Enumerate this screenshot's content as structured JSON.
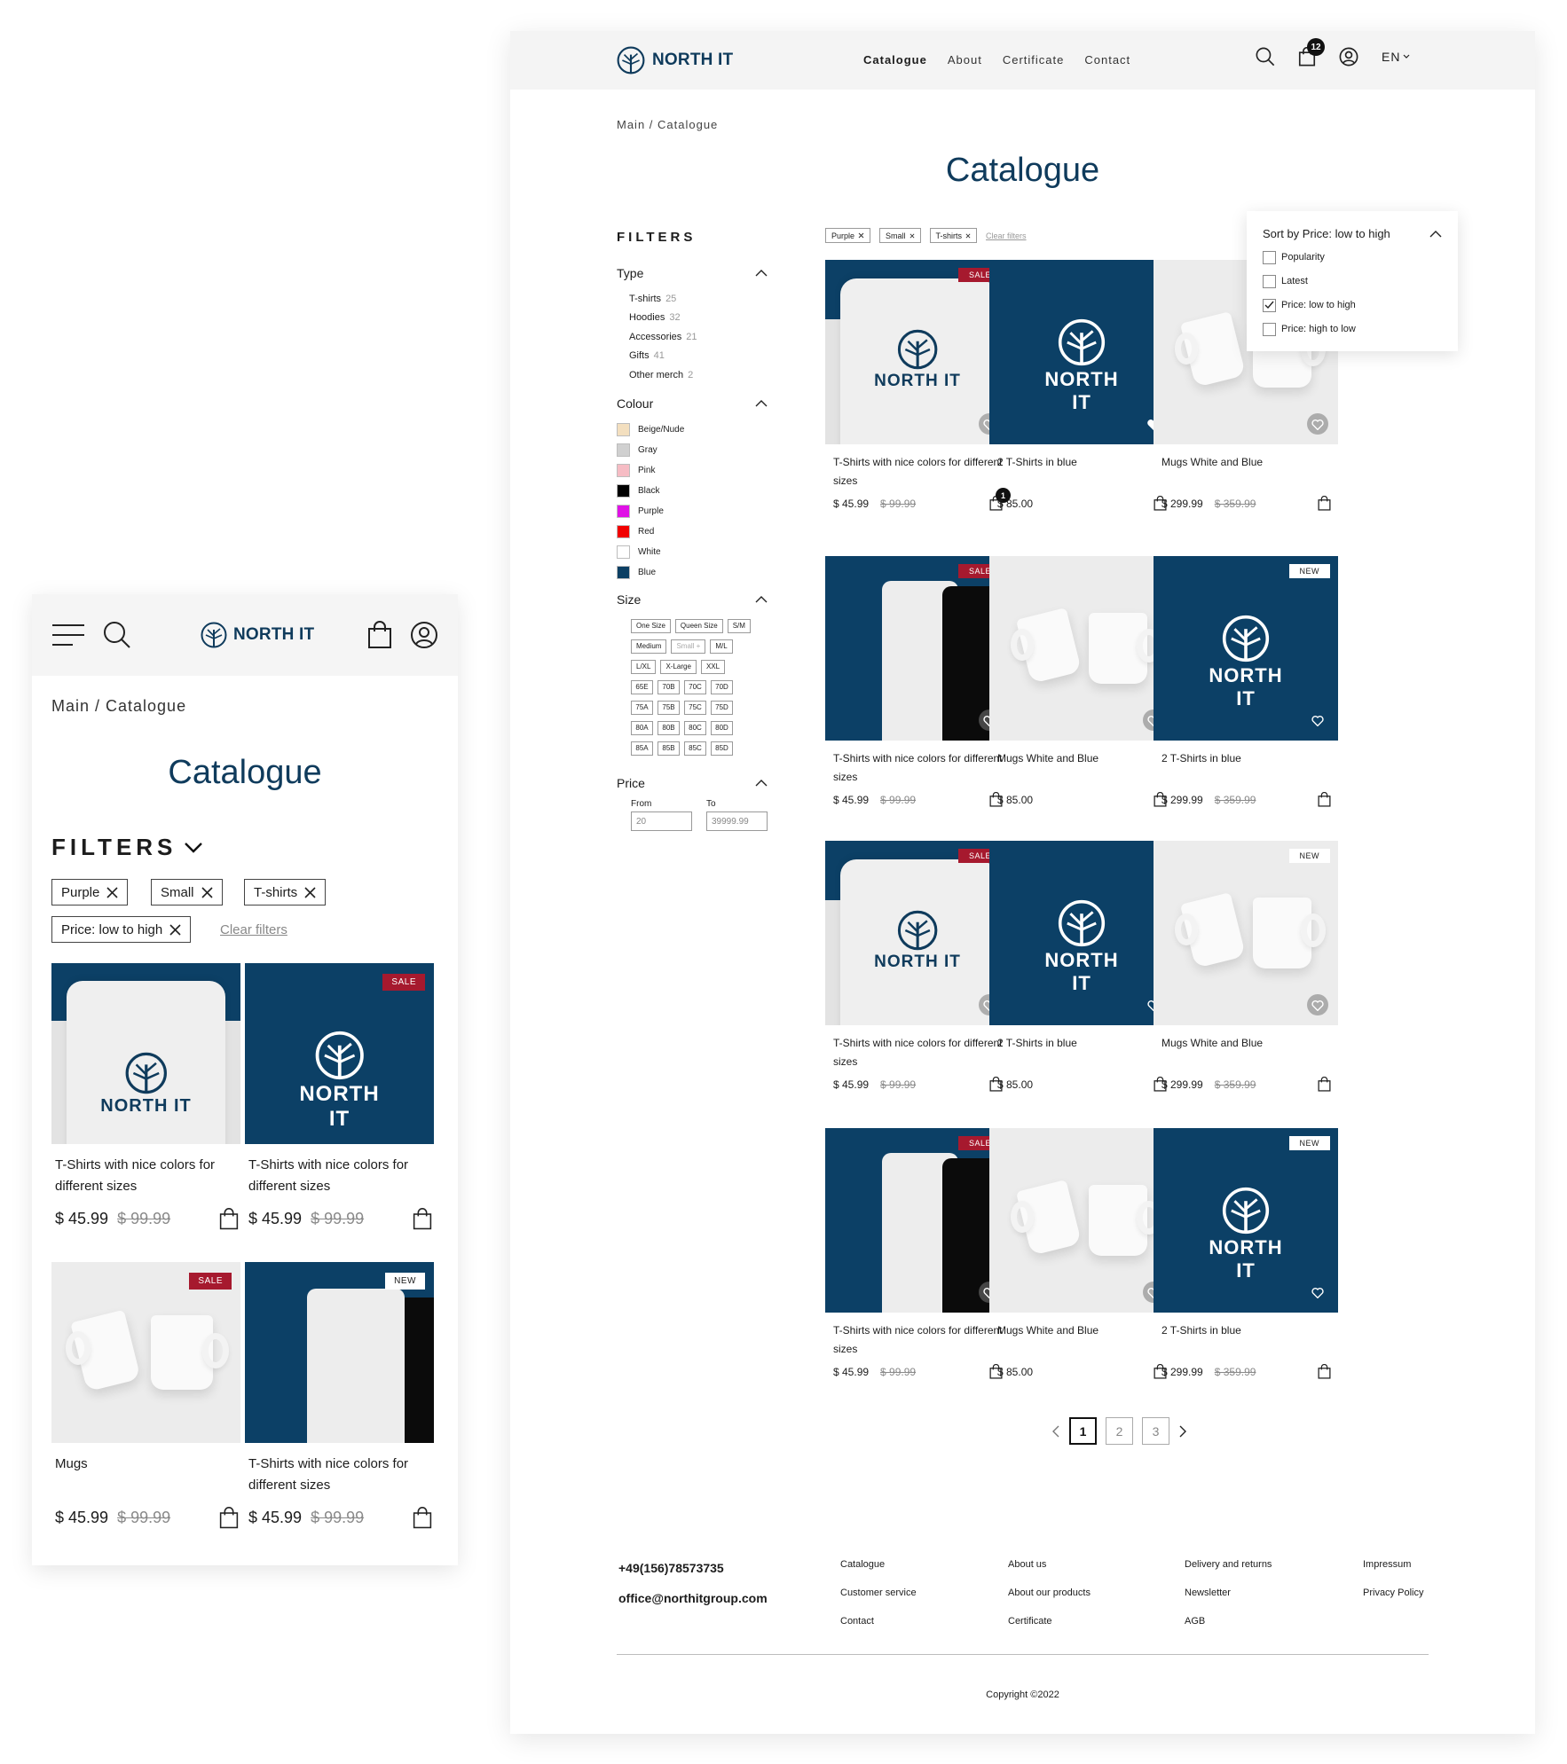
{
  "brand": {
    "name": "NORTH IT",
    "color": "#0f3b5c"
  },
  "colors": {
    "accent": "#0f3b5c",
    "sale_badge": "#a6192e",
    "shirt_blue": "#0c4066"
  },
  "icons": [
    "menu-icon",
    "search-icon",
    "shopping-bag-icon",
    "user-icon",
    "close-icon",
    "chevron-down-icon",
    "chevron-up-icon",
    "heart-icon",
    "chevron-left-icon",
    "chevron-right-icon",
    "checkmark-icon"
  ],
  "mobile": {
    "breadcrumb": "Main / Catalogue",
    "title": "Catalogue",
    "filters_label": "FILTERS",
    "chips": [
      "Purple",
      "Small",
      "T-shirts",
      "Price: low to high"
    ],
    "clear_filters": "Clear filters",
    "products": [
      {
        "name": "T-Shirts with nice colors for different sizes",
        "price": "$ 45.99",
        "old_price": "$ 99.99",
        "badge": "",
        "image": "white-shirt"
      },
      {
        "name": "T-Shirts with nice colors for different sizes",
        "price": "$ 45.99",
        "old_price": "$ 99.99",
        "badge": "SALE",
        "image": "blue-shirt"
      },
      {
        "name": "Mugs",
        "price": "$ 45.99",
        "old_price": "$ 99.99",
        "badge": "SALE",
        "image": "mugs"
      },
      {
        "name": "T-Shirts with nice colors for different sizes",
        "price": "$ 45.99",
        "old_price": "$ 99.99",
        "badge": "NEW",
        "image": "trio"
      }
    ]
  },
  "desktop": {
    "nav": [
      "Catalogue",
      "About",
      "Certificate",
      "Contact"
    ],
    "notification_count": "12",
    "language": "EN",
    "breadcrumb": "Main / Catalogue",
    "title": "Catalogue",
    "filters": {
      "heading": "FILTERS",
      "type": {
        "title": "Type",
        "items": [
          {
            "label": "T-shirts",
            "count": "25"
          },
          {
            "label": "Hoodies",
            "count": "32"
          },
          {
            "label": "Accessories",
            "count": "21"
          },
          {
            "label": "Gifts",
            "count": "41"
          },
          {
            "label": "Other merch",
            "count": "2"
          }
        ]
      },
      "colour": {
        "title": "Colour",
        "items": [
          {
            "label": "Beige/Nude",
            "hex": "#f3dfbf"
          },
          {
            "label": "Gray",
            "hex": "#d0d0d0"
          },
          {
            "label": "Pink",
            "hex": "#f6bcc4"
          },
          {
            "label": "Black",
            "hex": "#000000"
          },
          {
            "label": "Purple",
            "hex": "#e011e6"
          },
          {
            "label": "Red",
            "hex": "#f10000"
          },
          {
            "label": "White",
            "hex": "#ffffff"
          },
          {
            "label": "Blue",
            "hex": "#0c3f63"
          }
        ]
      },
      "size": {
        "title": "Size",
        "rows": [
          [
            "One Size",
            "Queen Size",
            "S/M"
          ],
          [
            "Medium",
            "Small +",
            "M/L"
          ],
          [
            "L/XL",
            "X-Large",
            "XXL"
          ],
          [
            "65E",
            "70B",
            "70C",
            "70D"
          ],
          [
            "75A",
            "75B",
            "75C",
            "75D"
          ],
          [
            "80A",
            "80B",
            "80C",
            "80D"
          ],
          [
            "85A",
            "85B",
            "85C",
            "85D"
          ]
        ]
      },
      "price": {
        "title": "Price",
        "from_label": "From",
        "to_label": "To",
        "from_value": "20",
        "to_value": "39999.99"
      }
    },
    "chips": [
      "Purple",
      "Small",
      "T-shirts"
    ],
    "clear_filters": "Clear filters",
    "sort": {
      "title": "Sort by Price: low to high",
      "options": [
        {
          "label": "Popularity",
          "checked": false
        },
        {
          "label": "Latest",
          "checked": false
        },
        {
          "label": "Price: low to high",
          "checked": true
        },
        {
          "label": "Price: high to low",
          "checked": false
        }
      ]
    },
    "products": [
      {
        "name": "T-Shirts with nice colors for different sizes",
        "price": "$ 45.99",
        "old_price": "$ 99.99",
        "badge": "SALE",
        "image": "white-shirt",
        "cart_count": "1"
      },
      {
        "name": "2 T-Shirts in blue",
        "price": "$ 85.00",
        "old_price": "",
        "badge": "",
        "image": "blue-shirt",
        "cart_count": ""
      },
      {
        "name": "Mugs White and Blue",
        "price": "$ 299.99",
        "old_price": "$ 359.99",
        "badge": "",
        "image": "mugs",
        "cart_count": ""
      },
      {
        "name": "T-Shirts with nice colors for different sizes",
        "price": "$ 45.99",
        "old_price": "$ 99.99",
        "badge": "SALE",
        "image": "trio",
        "cart_count": ""
      },
      {
        "name": "Mugs White and Blue",
        "price": "$ 85.00",
        "old_price": "",
        "badge": "",
        "image": "mugs",
        "cart_count": ""
      },
      {
        "name": "2 T-Shirts in blue",
        "price": "$ 299.99",
        "old_price": "$ 359.99",
        "badge": "NEW",
        "image": "blue-shirt",
        "cart_count": ""
      },
      {
        "name": "T-Shirts with nice colors for different sizes",
        "price": "$ 45.99",
        "old_price": "$ 99.99",
        "badge": "SALE",
        "image": "white-shirt",
        "cart_count": ""
      },
      {
        "name": "2 T-Shirts in blue",
        "price": "$ 85.00",
        "old_price": "",
        "badge": "",
        "image": "blue-shirt",
        "cart_count": ""
      },
      {
        "name": "Mugs White and Blue",
        "price": "$ 299.99",
        "old_price": "$ 359.99",
        "badge": "NEW",
        "image": "mugs",
        "cart_count": ""
      },
      {
        "name": "T-Shirts with nice colors for different sizes",
        "price": "$ 45.99",
        "old_price": "$ 99.99",
        "badge": "SALE",
        "image": "trio",
        "cart_count": ""
      },
      {
        "name": "Mugs White and Blue",
        "price": "$ 85.00",
        "old_price": "",
        "badge": "",
        "image": "mugs",
        "cart_count": ""
      },
      {
        "name": "2 T-Shirts in blue",
        "price": "$ 299.99",
        "old_price": "$ 359.99",
        "badge": "NEW",
        "image": "blue-shirt",
        "cart_count": ""
      }
    ],
    "pagination": [
      "1",
      "2",
      "3"
    ],
    "footer": {
      "phone": "+49(156)78573735",
      "email": "office@northitgroup.com",
      "col1": [
        "Catalogue",
        "Customer service",
        "Contact"
      ],
      "col2": [
        "About us",
        "About our products",
        "Certificate"
      ],
      "col3": [
        "Delivery and returns",
        "Newsletter",
        "AGB"
      ],
      "col4": [
        "Impressum",
        "Privacy Policy"
      ],
      "copyright": "Copyright ©2022"
    }
  }
}
